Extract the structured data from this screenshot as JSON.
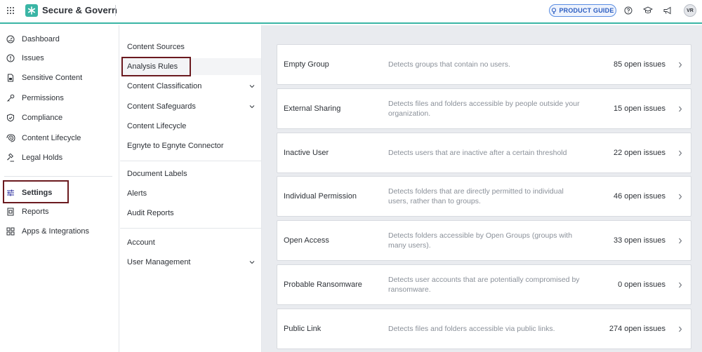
{
  "header": {
    "app_title": "Secure & Govern",
    "product_guide_label": "PRODUCT GUIDE",
    "avatar_initials": "VR",
    "accent_color": "#3ab5a5"
  },
  "leftnav": {
    "items": [
      {
        "label": "Dashboard",
        "icon": "dashboard-icon"
      },
      {
        "label": "Issues",
        "icon": "issues-icon"
      },
      {
        "label": "Sensitive Content",
        "icon": "sensitive-content-icon"
      },
      {
        "label": "Permissions",
        "icon": "key-icon"
      },
      {
        "label": "Compliance",
        "icon": "shield-icon"
      },
      {
        "label": "Content Lifecycle",
        "icon": "lifecycle-icon"
      },
      {
        "label": "Legal Holds",
        "icon": "gavel-icon"
      },
      {
        "label": "Settings",
        "icon": "sliders-icon"
      },
      {
        "label": "Reports",
        "icon": "reports-icon"
      },
      {
        "label": "Apps & Integrations",
        "icon": "apps-icon"
      }
    ]
  },
  "subnav": {
    "items": [
      {
        "label": "Content Sources"
      },
      {
        "label": "Analysis Rules"
      },
      {
        "label": "Content Classification"
      },
      {
        "label": "Content Safeguards"
      },
      {
        "label": "Content Lifecycle"
      },
      {
        "label": "Egnyte to Egnyte Connector"
      },
      {
        "label": "Document Labels"
      },
      {
        "label": "Alerts"
      },
      {
        "label": "Audit Reports"
      },
      {
        "label": "Account"
      },
      {
        "label": "User Management"
      }
    ]
  },
  "rules": [
    {
      "name": "Empty Group",
      "description": "Detects groups that contain no users.",
      "count": "85 open issues"
    },
    {
      "name": "External Sharing",
      "description": "Detects files and folders accessible by people outside your organization.",
      "count": "15 open issues"
    },
    {
      "name": "Inactive User",
      "description": "Detects users that are inactive after a certain threshold",
      "count": "22 open issues"
    },
    {
      "name": "Individual Permission",
      "description": "Detects folders that are directly permitted to individual users, rather than to groups.",
      "count": "46 open issues"
    },
    {
      "name": "Open Access",
      "description": "Detects folders accessible by Open Groups (groups with many users).",
      "count": "33 open issues"
    },
    {
      "name": "Probable Ransomware",
      "description": "Detects user accounts that are potentially compromised by ransomware.",
      "count": "0 open issues"
    },
    {
      "name": "Public Link",
      "description": "Detects files and folders accessible via public links.",
      "count": "274 open issues"
    }
  ]
}
